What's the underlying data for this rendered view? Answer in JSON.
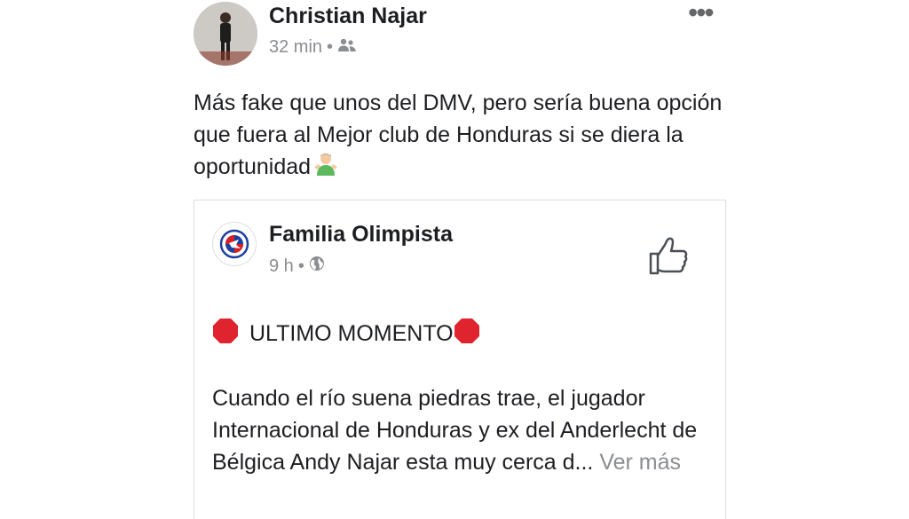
{
  "post": {
    "author": "Christian Najar",
    "time": "32 min",
    "separator": "•",
    "text": "Más fake que unos del DMV, pero sería buena opción que fuera al Mejor club de Honduras si se diera la oportunidad",
    "emoji_icon": "person-shrugging-icon",
    "audience_icon": "friends-icon",
    "more_icon": "more-options-icon",
    "more_label": "•••"
  },
  "shared": {
    "page_name": "Familia Olimpista",
    "time": "9 h",
    "separator": "•",
    "audience_icon": "globe-icon",
    "like_icon": "thumbs-up-icon",
    "headline": "ULTIMO MOMENTO",
    "headline_icon": "stop-sign-icon",
    "body": "Cuando el río suena piedras trae, el jugador Internacional de Honduras y ex del Anderlecht de Bélgica Andy Najar esta muy cerca d...",
    "see_more": "Ver más"
  },
  "colors": {
    "text": "#1c1e21",
    "secondary": "#8a8d91",
    "border": "#dadde1",
    "stop_red": "#e0242f",
    "logo_blue": "#1d3fa0",
    "logo_red": "#d71f26"
  }
}
